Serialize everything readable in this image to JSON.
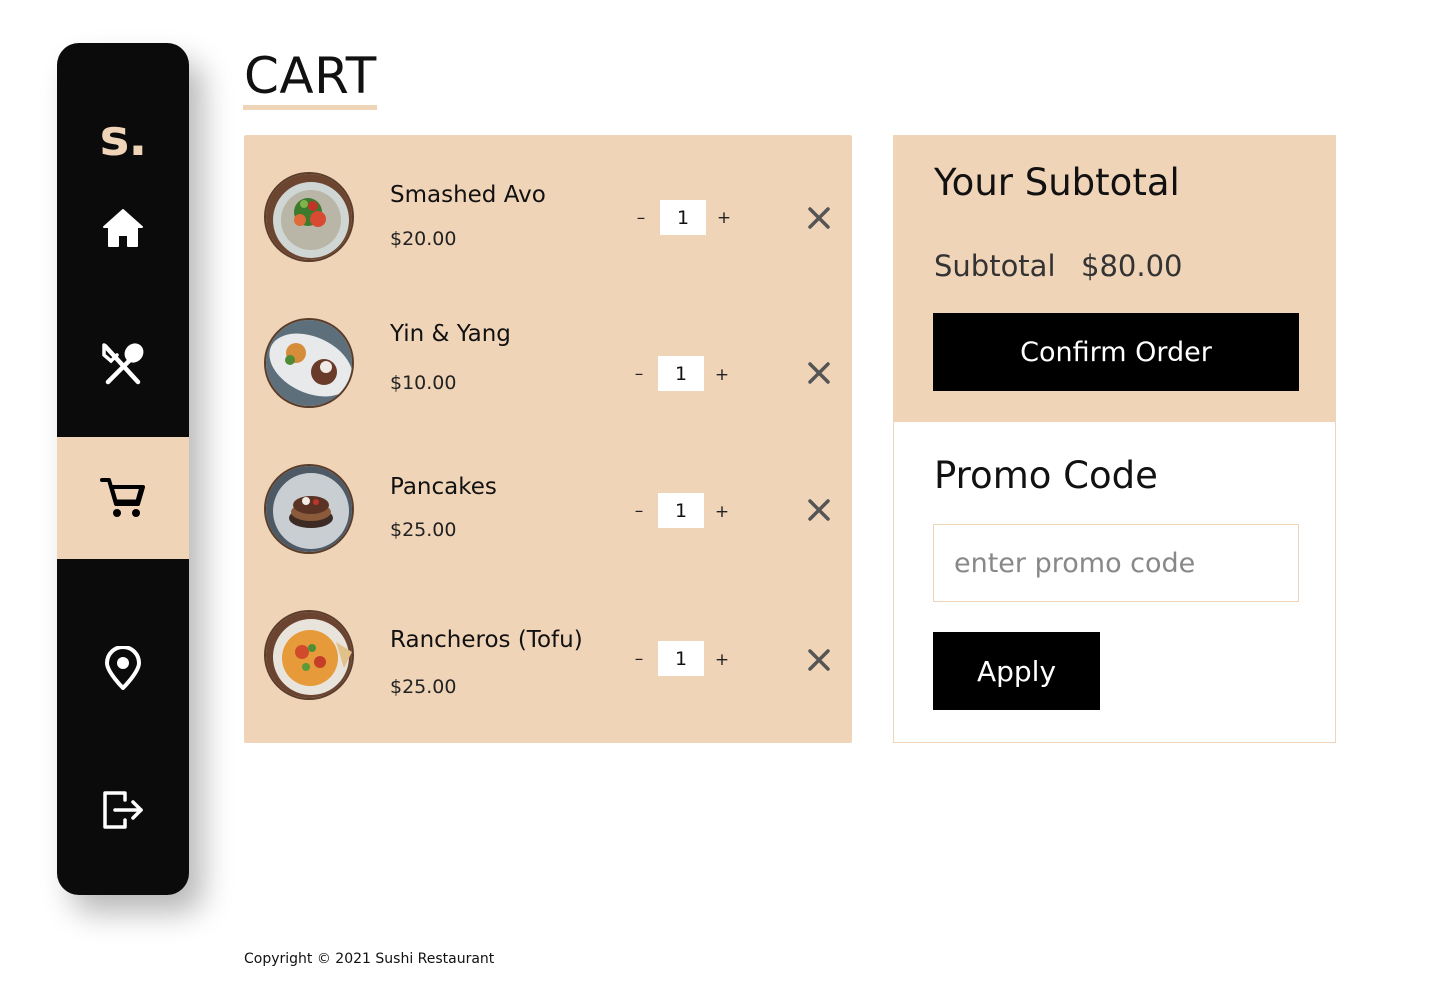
{
  "app": {
    "logo_text": "s.",
    "accent_color": "#f0d4b8",
    "sidebar_color": "#0b0b0b"
  },
  "sidebar": {
    "items": [
      {
        "name": "home",
        "icon": "home-icon",
        "active": false
      },
      {
        "name": "menu",
        "icon": "utensils-icon",
        "active": false
      },
      {
        "name": "cart",
        "icon": "cart-icon",
        "active": true
      },
      {
        "name": "location",
        "icon": "map-pin-icon",
        "active": false
      },
      {
        "name": "logout",
        "icon": "logout-icon",
        "active": false
      }
    ]
  },
  "page": {
    "title": "CART"
  },
  "cart": {
    "items": [
      {
        "name": "Smashed Avo",
        "price": "$20.00",
        "quantity": "1",
        "minus_label": "–",
        "plus_label": "+"
      },
      {
        "name": "Yin & Yang",
        "price": "$10.00",
        "quantity": "1",
        "minus_label": "–",
        "plus_label": "+"
      },
      {
        "name": "Pancakes",
        "price": "$25.00",
        "quantity": "1",
        "minus_label": "–",
        "plus_label": "+"
      },
      {
        "name": "Rancheros (Tofu)",
        "price": "$25.00",
        "quantity": "1",
        "minus_label": "–",
        "plus_label": "+"
      }
    ]
  },
  "summary": {
    "heading": "Your Subtotal",
    "subtotal_label": "Subtotal",
    "subtotal_value": "$80.00",
    "confirm_label": "Confirm Order"
  },
  "promo": {
    "heading": "Promo Code",
    "placeholder": "enter promo code",
    "value": "",
    "apply_label": "Apply"
  },
  "footer": {
    "copyright": "Copyright © 2021 Sushi Restaurant"
  }
}
